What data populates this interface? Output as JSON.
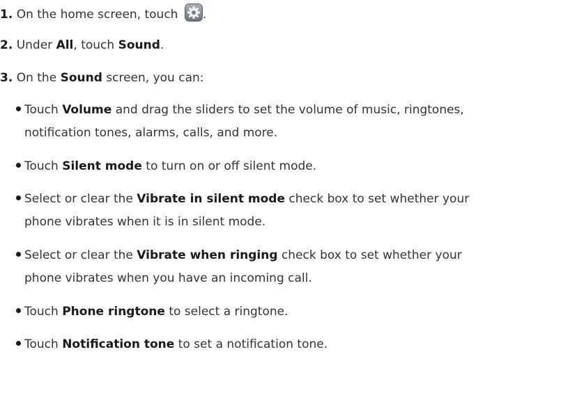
{
  "steps": [
    {
      "num": "1.",
      "pre": "On the home screen, touch",
      "post": "."
    },
    {
      "num": "2.",
      "t1": "Under ",
      "b1": "All",
      "t2": ", touch ",
      "b2": "Sound",
      "t3": "."
    },
    {
      "num": "3.",
      "t1": "On the ",
      "b1": "Sound",
      "t2": " screen, you can:"
    }
  ],
  "bullets": [
    {
      "pre": "Touch ",
      "bold": "Volume",
      "post": " and drag the sliders to set the volume of music, ringtones,",
      "cont": "notification tones, alarms, calls, and more."
    },
    {
      "pre": "Touch ",
      "bold": "Silent mode",
      "post": " to turn on or off silent mode."
    },
    {
      "pre": "Select or clear the ",
      "bold": "Vibrate in silent mode",
      "post": " check box to set whether your",
      "cont": "phone vibrates when it is in silent mode."
    },
    {
      "pre": "Select or clear the ",
      "bold": "Vibrate when ringing",
      "post": " check box to set whether your",
      "cont": "phone vibrates when you have an incoming call."
    },
    {
      "pre": "Touch ",
      "bold": "Phone ringtone",
      "post": " to select a ringtone."
    },
    {
      "pre": "Touch ",
      "bold": "Notification tone",
      "post": " to set a notification tone."
    }
  ],
  "icons": {
    "settings": "gear-icon"
  }
}
